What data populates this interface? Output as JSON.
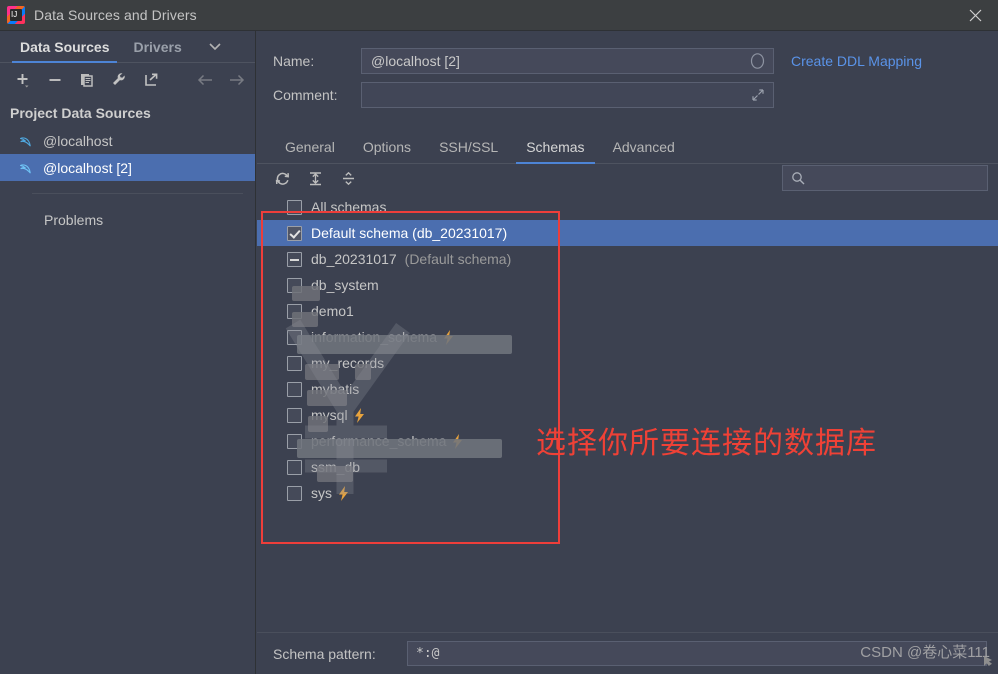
{
  "window": {
    "title": "Data Sources and Drivers",
    "app_icon": "intellij-idea-icon",
    "close_icon": "close-icon"
  },
  "sidebar": {
    "tabs": [
      {
        "label": "Data Sources",
        "active": true
      },
      {
        "label": "Drivers",
        "active": false
      }
    ],
    "caret_icon": "chevron-down-icon",
    "toolbar": [
      {
        "name": "add-data-source-button",
        "icon": "plus-icon"
      },
      {
        "name": "remove-data-source-button",
        "icon": "minus-icon"
      },
      {
        "name": "duplicate-data-source-button",
        "icon": "copy-icon"
      },
      {
        "name": "properties-button",
        "icon": "wrench-icon"
      },
      {
        "name": "import-export-button",
        "icon": "export-arrow-icon"
      },
      {
        "name": "navigate-back-button",
        "icon": "arrow-left-icon"
      },
      {
        "name": "navigate-forward-button",
        "icon": "arrow-right-icon"
      }
    ],
    "section_title": "Project Data Sources",
    "items": [
      {
        "label": "@localhost",
        "icon": "mysql-dolphin-icon",
        "selected": false
      },
      {
        "label": "@localhost [2]",
        "icon": "mysql-dolphin-icon",
        "selected": true
      }
    ],
    "problems_label": "Problems"
  },
  "details": {
    "name_label": "Name:",
    "name_value": "@localhost [2]",
    "name_adorn_icon": "circle-icon",
    "comment_label": "Comment:",
    "comment_value": "",
    "comment_adorn_icon": "expand-diagonal-icon",
    "ddl_link": "Create DDL Mapping"
  },
  "tabs": [
    {
      "label": "General",
      "active": false
    },
    {
      "label": "Options",
      "active": false
    },
    {
      "label": "SSH/SSL",
      "active": false
    },
    {
      "label": "Schemas",
      "active": true
    },
    {
      "label": "Advanced",
      "active": false
    }
  ],
  "tree_toolbar": [
    {
      "name": "refresh-button",
      "icon": "refresh-icon"
    },
    {
      "name": "expand-all-button",
      "icon": "expand-all-icon"
    },
    {
      "name": "collapse-all-button",
      "icon": "collapse-all-icon"
    }
  ],
  "search": {
    "icon": "search-icon",
    "value": "",
    "placeholder": ""
  },
  "schemas": [
    {
      "label": "All schemas",
      "state": "unchecked",
      "selected": false,
      "suffix": "",
      "badge": "",
      "obscured": false
    },
    {
      "label": "Default schema (db_20231017)",
      "state": "checked",
      "selected": true,
      "suffix": "",
      "badge": "",
      "obscured": false
    },
    {
      "label": "db_20231017",
      "state": "indeterminate",
      "selected": false,
      "suffix": "(Default schema)",
      "badge": "",
      "obscured": false
    },
    {
      "label": "db_system",
      "state": "unchecked",
      "selected": false,
      "suffix": "",
      "badge": "",
      "obscured": true
    },
    {
      "label": "demo1",
      "state": "unchecked",
      "selected": false,
      "suffix": "",
      "badge": "",
      "obscured": true
    },
    {
      "label": "information_schema",
      "state": "unchecked",
      "selected": false,
      "suffix": "",
      "badge": "lightning-icon",
      "obscured": true
    },
    {
      "label": "my_records",
      "state": "unchecked",
      "selected": false,
      "suffix": "",
      "badge": "",
      "obscured": true
    },
    {
      "label": "mybatis",
      "state": "unchecked",
      "selected": false,
      "suffix": "",
      "badge": "",
      "obscured": true
    },
    {
      "label": "mysql",
      "state": "unchecked",
      "selected": false,
      "suffix": "",
      "badge": "lightning-icon",
      "obscured": true
    },
    {
      "label": "performance_schema",
      "state": "unchecked",
      "selected": false,
      "suffix": "",
      "badge": "lightning-icon",
      "obscured": true
    },
    {
      "label": "ssm_db",
      "state": "unchecked",
      "selected": false,
      "suffix": "",
      "badge": "",
      "obscured": true
    },
    {
      "label": "sys",
      "state": "unchecked",
      "selected": false,
      "suffix": "",
      "badge": "lightning-icon",
      "obscured": false
    }
  ],
  "annotation": {
    "text": "选择你所要连接的数据库",
    "color": "#ef4136"
  },
  "bottom": {
    "pattern_label": "Schema pattern:",
    "pattern_value": "*:@"
  },
  "watermark": {
    "text": "CSDN @卷心菜111"
  },
  "colors": {
    "background": "#3c4150",
    "titlebar": "#3c3f41",
    "selection": "#4b6eaf",
    "accent": "#4d84d6",
    "link": "#5a93e8",
    "annotation": "#ef4136"
  }
}
